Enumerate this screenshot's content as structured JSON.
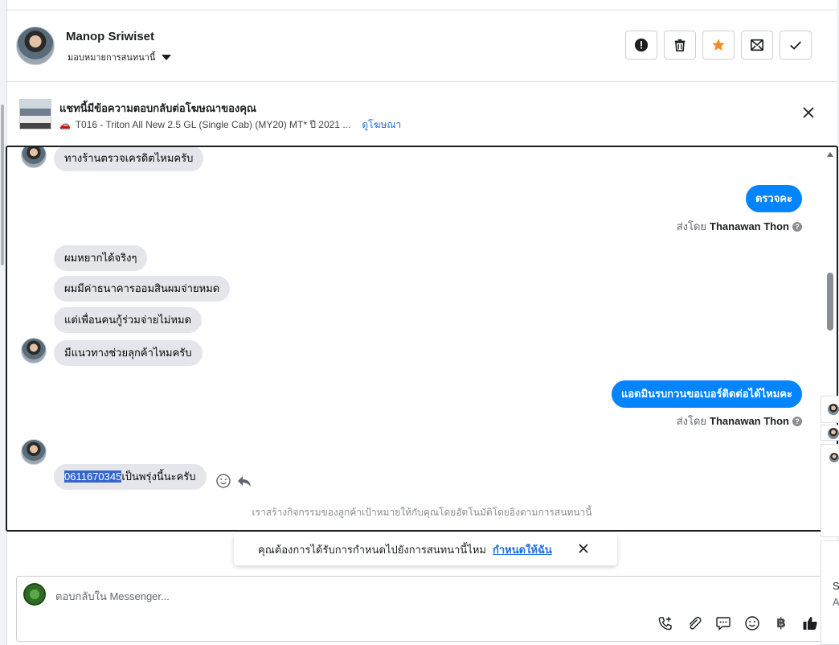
{
  "header": {
    "user_name": "Manop Sriwiset",
    "assign_label": "มอบหมายการสนทนานี้",
    "actions": [
      "spam-icon",
      "trash-icon",
      "star-icon",
      "mark-unread-icon",
      "done-icon"
    ],
    "star_color": "#f28c28"
  },
  "ad": {
    "title": "แชทนี้มีข้อความตอบกลับต่อโฆษณาของคุณ",
    "product": "T016 - Triton All New 2.5 GL (Single Cab) (MY20) MT* ปี 2021 ...",
    "link": "ดูโฆษณา"
  },
  "messages": {
    "m1": "ทางร้านตรวจเครดิตไหมครับ",
    "m2": "ตรวจคะ",
    "m3": "ผมหยากได้จริงๆ",
    "m4": "ผมมีค่าธนาคารออมสินผมจ่ายหมด",
    "m5": "แต่เพื่อนคนกู้ร่วมจ่ายไม่หมด",
    "m6": "มีแนวทางช่วยลุกค้าไหมครับ",
    "m7": "แอดมินรบกวนขอเบอร์ติดต่อได้ไหมคะ",
    "m8_highlight": "0611670345",
    "m8_rest": "เป็นพรุ่งนี้นะครับ"
  },
  "sent_by": {
    "prefix": "ส่งโดย",
    "name": "Thanawan Thon"
  },
  "auto_note": "เราสร้างกิจกรรมของลูกค้าเป้าหมายให้กับคุณโดยอัตโนมัติโดยอิงตามการสนทนานี้",
  "assign_prompt": {
    "text": "คุณต้องการได้รับการกำหนดไปยังการสนทนานี้ไหม",
    "link": "กำหนดให้ฉัน"
  },
  "composer": {
    "placeholder": "ตอบกลับใน Messenger...",
    "tools": [
      "phone-plus-icon",
      "attach-icon",
      "saved-reply-icon",
      "emoji-icon",
      "baht-icon",
      "thumbs-up-icon"
    ],
    "baht_symbol": "฿"
  },
  "edge": {
    "letter1": "S",
    "letter2": "A"
  },
  "colors": {
    "outgoing_bubble": "#0084ff",
    "incoming_bubble": "#e4e6eb",
    "link": "#216fdb",
    "highlight": "#3366cc"
  }
}
